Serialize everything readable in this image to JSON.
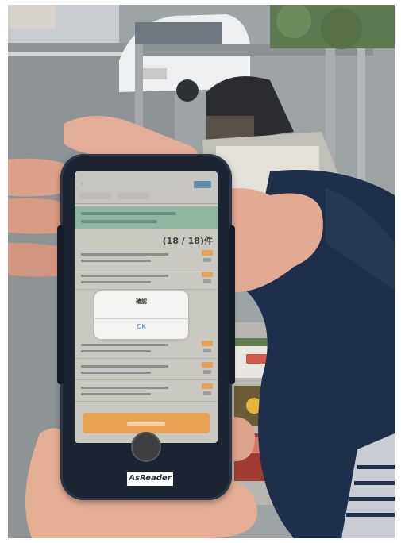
{
  "screen": {
    "nav_title": "",
    "count_text": "(18 / 18)件",
    "alert": {
      "title": "確認",
      "message": "",
      "ok_label": "OK"
    }
  },
  "device": {
    "brand_label": "AsReader"
  },
  "colors": {
    "phone_case": "#1c2431",
    "action_button": "#eaa352",
    "status_bar_green": "#8fb6a1",
    "alert_ok": "#3b7fd8",
    "jacket": "#1d2f4a"
  }
}
